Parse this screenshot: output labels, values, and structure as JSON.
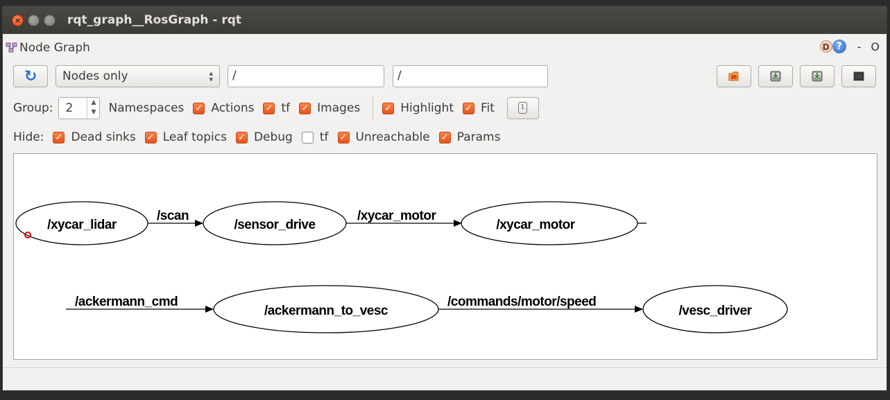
{
  "window": {
    "title": "rqt_graph__RosGraph - rqt",
    "close_glyph": "×"
  },
  "plugin": {
    "title": "Node Graph",
    "help_d": "D",
    "help_q": "?",
    "dash": "-",
    "close_o": "O"
  },
  "toolbar": {
    "mode_value": "Nodes only",
    "mode_arrows": "⌃⌄",
    "node_filter_value": "/",
    "topic_filter_value": "/"
  },
  "group_row": {
    "group_label": "Group:",
    "group_value": "2",
    "namespaces_label": "Namespaces",
    "actions_label": "Actions",
    "tf_label": "tf",
    "images_label": "Images",
    "highlight_label": "Highlight",
    "fit_label": "Fit"
  },
  "hide_row": {
    "hide_label": "Hide:",
    "dead_sinks_label": "Dead sinks",
    "leaf_topics_label": "Leaf topics",
    "debug_label": "Debug",
    "tf_label": "tf",
    "unreachable_label": "Unreachable",
    "params_label": "Params"
  },
  "checkboxes": {
    "namespaces": true,
    "actions": true,
    "tf": true,
    "images": true,
    "highlight": true,
    "fit": true,
    "dead_sinks": true,
    "leaf_topics": true,
    "debug": true,
    "hide_tf": false,
    "unreachable": true,
    "params": true
  },
  "graph": {
    "nodes": [
      "/xycar_lidar",
      "/sensor_drive",
      "/xycar_motor",
      "/ackermann_to_vesc",
      "/vesc_driver"
    ],
    "edges": [
      "/scan",
      "/xycar_motor",
      "/ackermann_cmd",
      "/commands/motor/speed"
    ]
  },
  "colors": {
    "checkbox_accent": "#e95f22",
    "titlebar": "#3c3b37",
    "refresh": "#2e6fd0"
  }
}
